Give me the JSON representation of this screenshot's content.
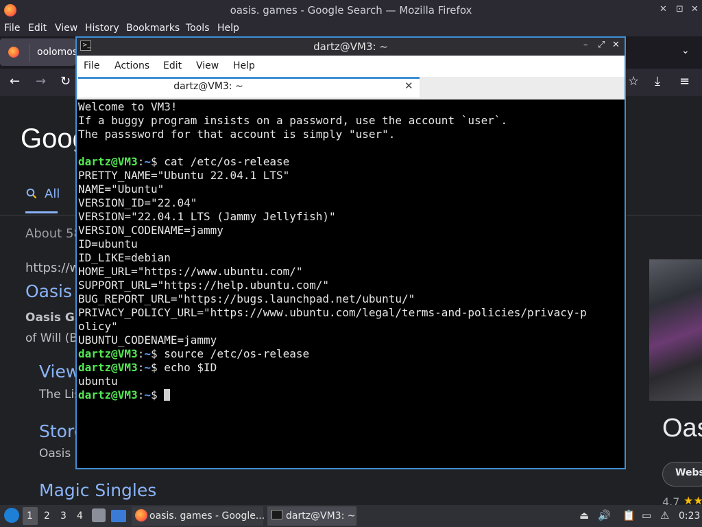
{
  "firefox": {
    "window_title": "oasis. games - Google Search — Mozilla Firefox",
    "menu": [
      "File",
      "Edit",
      "View",
      "History",
      "Bookmarks",
      "Tools",
      "Help"
    ],
    "tab_label": "oolomos"
  },
  "google": {
    "logo": "Goog",
    "tab_all": "All",
    "about": "About 58",
    "url": "https://ww",
    "result_title": "Oasis",
    "snippet_bold": "Oasis Ga",
    "snippet2": "of Will (B",
    "sub1_title": "View",
    "sub1_text": "The Lis",
    "sub2_title": "Store",
    "sub2_text": "Oasis",
    "sub3_title": "Magic Singles",
    "kp_title": "Oas",
    "kp_button": "Webs",
    "kp_rating": "4.7",
    "kp_stars": "★★"
  },
  "terminal": {
    "window_title": "dartz@VM3: ~",
    "menu": [
      "File",
      "Actions",
      "Edit",
      "View",
      "Help"
    ],
    "tab_label": "dartz@VM3: ~",
    "prompt_user": "dartz@VM3",
    "prompt_path": "~",
    "welcome": [
      "Welcome to VM3!",
      "If a buggy program insists on a password, use the account `user`.",
      "The passsword for that account is simply \"user\"."
    ],
    "cmd1": "cat /etc/os-release",
    "os_release": [
      "PRETTY_NAME=\"Ubuntu 22.04.1 LTS\"",
      "NAME=\"Ubuntu\"",
      "VERSION_ID=\"22.04\"",
      "VERSION=\"22.04.1 LTS (Jammy Jellyfish)\"",
      "VERSION_CODENAME=jammy",
      "ID=ubuntu",
      "ID_LIKE=debian",
      "HOME_URL=\"https://www.ubuntu.com/\"",
      "SUPPORT_URL=\"https://help.ubuntu.com/\"",
      "BUG_REPORT_URL=\"https://bugs.launchpad.net/ubuntu/\"",
      "PRIVACY_POLICY_URL=\"https://www.ubuntu.com/legal/terms-and-policies/privacy-p",
      "olicy\"",
      "UBUNTU_CODENAME=jammy"
    ],
    "cmd2": "source /etc/os-release",
    "cmd3": "echo $ID",
    "output3": "ubuntu"
  },
  "taskbar": {
    "workspaces": [
      "1",
      "2",
      "3",
      "4"
    ],
    "app1_label": "oasis. games - Google...",
    "app2_label": "dartz@VM3: ~",
    "clock": "0:23"
  }
}
